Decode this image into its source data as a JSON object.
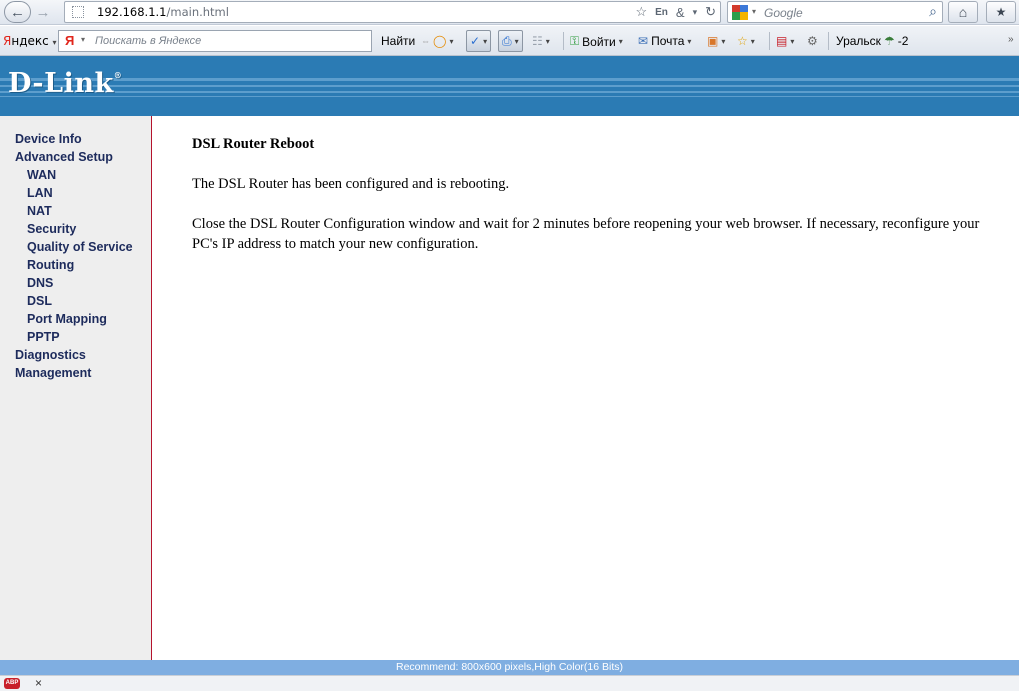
{
  "browser": {
    "url_host": "192.168.1.1",
    "url_path": "/main.html",
    "search_placeholder": "Google",
    "nav_icons": [
      "back-arrow-icon",
      "forward-arrow-icon",
      "star-icon",
      "reload-icon",
      "home-icon",
      "bookmark-icon"
    ]
  },
  "yandex_toolbar": {
    "brand_first": "Я",
    "brand_rest": "ндекс",
    "search_placeholder": "Поискать в Яндексе",
    "find_label": "Найти",
    "login_label": "Войти",
    "mail_label": "Почта",
    "city_label": "Уральск",
    "temperature": "-2"
  },
  "header": {
    "logo_text": "D-Link",
    "logo_mark": "®"
  },
  "sidebar": {
    "items": [
      {
        "label": "Device Info",
        "level": 1
      },
      {
        "label": "Advanced Setup",
        "level": 1
      },
      {
        "label": "WAN",
        "level": 2
      },
      {
        "label": "LAN",
        "level": 2
      },
      {
        "label": "NAT",
        "level": 2
      },
      {
        "label": "Security",
        "level": 2
      },
      {
        "label": "Quality of Service",
        "level": 2
      },
      {
        "label": "Routing",
        "level": 2
      },
      {
        "label": "DNS",
        "level": 2
      },
      {
        "label": "DSL",
        "level": 2
      },
      {
        "label": "Port Mapping",
        "level": 2
      },
      {
        "label": "PPTP",
        "level": 2
      },
      {
        "label": "Diagnostics",
        "level": 1
      },
      {
        "label": "Management",
        "level": 1
      }
    ]
  },
  "main": {
    "title": "DSL Router Reboot",
    "paragraph1": "The DSL Router has been configured and is rebooting.",
    "paragraph2": "Close the DSL Router Configuration window and wait for 2 minutes before reopening your web browser. If necessary, reconfigure your PC's IP address to match your new configuration."
  },
  "footer": {
    "text": "Recommend: 800x600 pixels,High Color(16 Bits)"
  },
  "statusbar": {
    "abp_label": "ABP",
    "close_label": "×"
  },
  "colors": {
    "header_blue": "#2b7bb4",
    "footer_blue": "#7faee1",
    "sidebar_bg": "#eeeeee",
    "sidebar_border": "#b4132d",
    "menu_text": "#1d2b5c"
  }
}
